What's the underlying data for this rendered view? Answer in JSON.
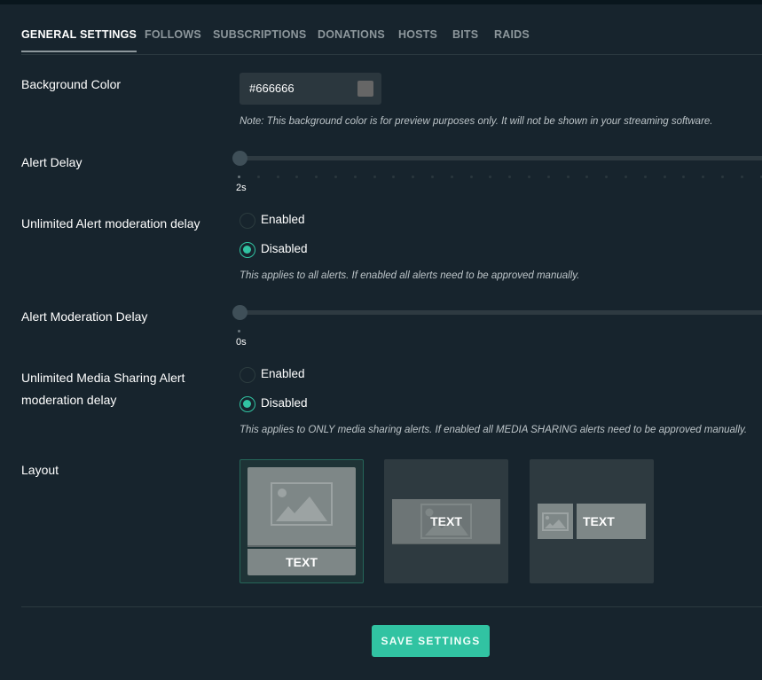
{
  "tabs": [
    {
      "label": "GENERAL SETTINGS",
      "active": true
    },
    {
      "label": "FOLLOWS",
      "active": false
    },
    {
      "label": "SUBSCRIPTIONS",
      "active": false
    },
    {
      "label": "DONATIONS",
      "active": false
    },
    {
      "label": "HOSTS",
      "active": false
    },
    {
      "label": "BITS",
      "active": false
    },
    {
      "label": "RAIDS",
      "active": false
    }
  ],
  "background_color": {
    "label": "Background Color",
    "value": "#666666",
    "swatch_color": "#666666",
    "note": "Note: This background color is for preview purposes only. It will not be shown in your streaming software."
  },
  "alert_delay": {
    "label": "Alert Delay",
    "value_text": "2s",
    "fraction": 0
  },
  "unlimited_alert_moderation": {
    "label": "Unlimited Alert moderation delay",
    "options": [
      "Enabled",
      "Disabled"
    ],
    "selected": "Disabled",
    "note": "This applies to all alerts. If enabled all alerts need to be approved manually."
  },
  "alert_moderation_delay": {
    "label": "Alert Moderation Delay",
    "value_text": "0s",
    "fraction": 0
  },
  "unlimited_media_sharing": {
    "label_line1": "Unlimited Media Sharing Alert",
    "label_line2": "moderation delay",
    "options": [
      "Enabled",
      "Disabled"
    ],
    "selected": "Disabled",
    "note": "This applies to ONLY media sharing alerts. If enabled all MEDIA SHARING alerts need to be approved manually."
  },
  "layout": {
    "label": "Layout",
    "options": [
      {
        "name": "image-above-text",
        "text": "TEXT",
        "selected": true
      },
      {
        "name": "text-over-image",
        "text": "TEXT",
        "selected": false
      },
      {
        "name": "image-left-text",
        "text": "TEXT",
        "selected": false
      }
    ]
  },
  "save_button": {
    "label": "SAVE SETTINGS"
  },
  "colors": {
    "accent": "#31c3a2",
    "background": "#17242d",
    "muted_text": "#8d979c"
  }
}
